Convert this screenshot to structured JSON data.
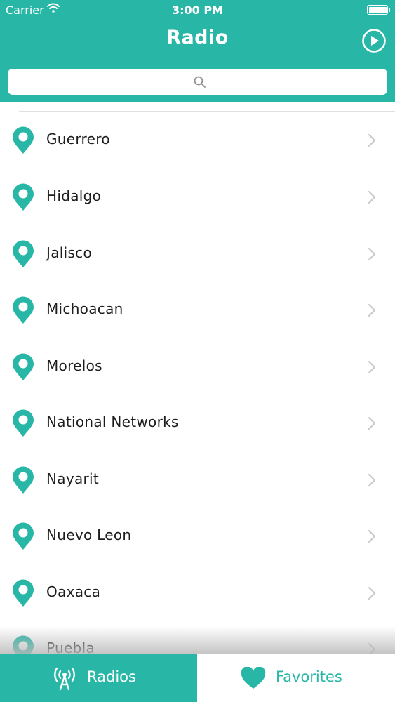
{
  "status_bar": {
    "carrier": "Carrier",
    "time": "3:00 PM"
  },
  "nav": {
    "title": "Radio",
    "play_icon": "play-circle-icon"
  },
  "search": {
    "placeholder": "",
    "value": "",
    "icon": "search-icon"
  },
  "colors": {
    "accent": "#28b7a6",
    "text": "#1d1d1d",
    "separator": "#e0e0e0",
    "chevron": "#c7c7cc"
  },
  "list": {
    "items": [
      {
        "label": "Guerrero",
        "icon": "map-pin-icon"
      },
      {
        "label": "Hidalgo",
        "icon": "map-pin-icon"
      },
      {
        "label": "Jalisco",
        "icon": "map-pin-icon"
      },
      {
        "label": "Michoacan",
        "icon": "map-pin-icon"
      },
      {
        "label": "Morelos",
        "icon": "map-pin-icon"
      },
      {
        "label": "National Networks",
        "icon": "map-pin-icon"
      },
      {
        "label": "Nayarit",
        "icon": "map-pin-icon"
      },
      {
        "label": "Nuevo Leon",
        "icon": "map-pin-icon"
      },
      {
        "label": "Oaxaca",
        "icon": "map-pin-icon"
      },
      {
        "label": "Puebla",
        "icon": "map-pin-icon"
      }
    ]
  },
  "tabbar": {
    "tabs": [
      {
        "label": "Radios",
        "icon": "radio-tower-icon",
        "selected": true
      },
      {
        "label": "Favorites",
        "icon": "heart-icon",
        "selected": false
      }
    ]
  }
}
